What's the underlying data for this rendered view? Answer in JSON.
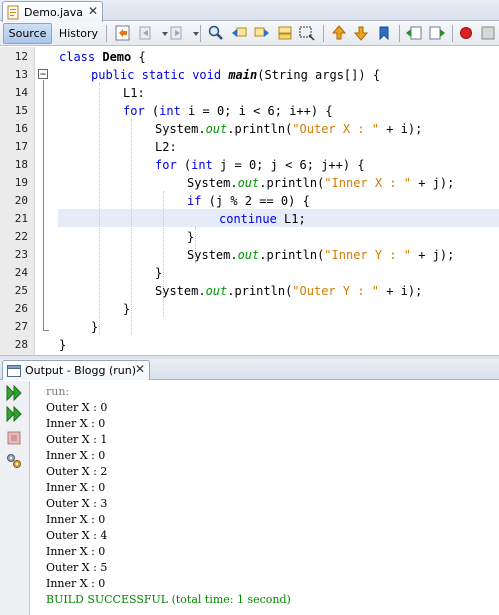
{
  "editor_tab": {
    "filename": "Demo.java",
    "close": "✕"
  },
  "toolbar": {
    "source_label": "Source",
    "history_label": "History"
  },
  "editor": {
    "line_numbers": [
      "12",
      "13",
      "14",
      "15",
      "16",
      "17",
      "18",
      "19",
      "20",
      "21",
      "22",
      "23",
      "24",
      "25",
      "26",
      "27",
      "28"
    ],
    "current_line": "21"
  },
  "output_tab": {
    "title": "Output - Blogg (run)",
    "close": "✕"
  },
  "output": {
    "lines": [
      "run:",
      "Outer X : 0",
      "Inner X : 0",
      "Outer X : 1",
      "Inner X : 0",
      "Outer X : 2",
      "Inner X : 0",
      "Outer X : 3",
      "Inner X : 0",
      "Outer X : 4",
      "Inner X : 0",
      "Outer X : 5",
      "Inner X : 0",
      "BUILD SUCCESSFUL (total time: 1 second)"
    ]
  },
  "colors": {
    "keyword": "#0000e6",
    "string": "#ce7b00",
    "static_field": "#009900",
    "build_success": "#008800",
    "run_label": "#808080",
    "current_line_highlight": "#e6ecf7"
  },
  "code": {
    "l12": {
      "kw": "class",
      "name": "Demo",
      "rest": " {"
    },
    "l13": {
      "kw1": "public",
      "kw2": "static",
      "kw3": "void",
      "method": "main",
      "rest": "(String args[]) {"
    },
    "l14": {
      "text": "L1:"
    },
    "l15": {
      "kw": "for",
      "p1": " (",
      "kw2": "int",
      "rest": " i = 0; i < 6; i++) {"
    },
    "l16": {
      "a": "System.",
      "field": "out",
      "b": ".println(",
      "str": "\"Outer X : \"",
      "c": " + i);"
    },
    "l17": {
      "text": "L2:"
    },
    "l18": {
      "kw": "for",
      "p1": " (",
      "kw2": "int",
      "rest": " j = 0; j < 6; j++) {"
    },
    "l19": {
      "a": "System.",
      "field": "out",
      "b": ".println(",
      "str": "\"Inner X : \"",
      "c": " + j);"
    },
    "l20": {
      "kw": "if",
      "rest": " (j % 2 == 0) {"
    },
    "l21": {
      "kw": "continue",
      "rest": " L1;"
    },
    "l22": {
      "text": "}"
    },
    "l23": {
      "a": "System.",
      "field": "out",
      "b": ".println(",
      "str": "\"Inner Y : \"",
      "c": " + j);"
    },
    "l24": {
      "text": "}"
    },
    "l25": {
      "a": "System.",
      "field": "out",
      "b": ".println(",
      "str": "\"Outer Y : \"",
      "c": " + i);"
    },
    "l26": {
      "text": "}"
    },
    "l27": {
      "text": "}"
    },
    "l28": {
      "text": "}"
    }
  }
}
